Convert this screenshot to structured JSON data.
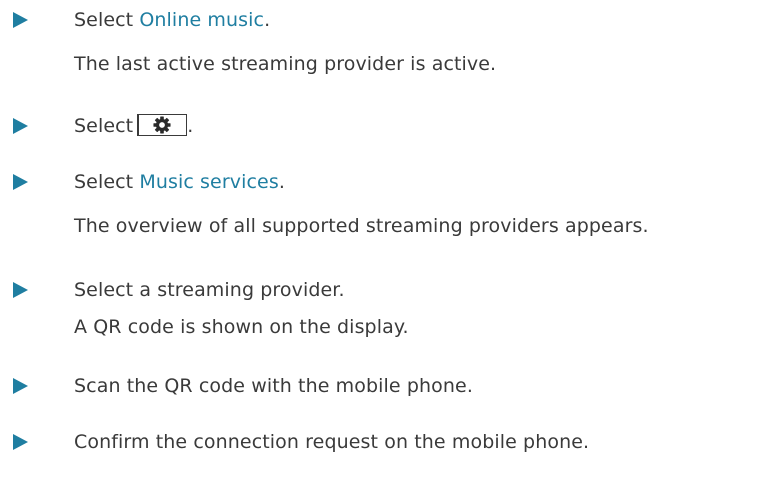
{
  "steps": [
    {
      "prefix": "Select ",
      "link": "Online music",
      "suffix": ".",
      "result": "The last active streaming provider is active."
    },
    {
      "prefix": "Select",
      "icon": "gear-icon",
      "suffix": "."
    },
    {
      "prefix": "Select ",
      "link": "Music services",
      "suffix": ".",
      "result": "The overview of all supported streaming providers appears."
    },
    {
      "text": "Select a streaming provider.",
      "result": "A QR code is shown on the display."
    },
    {
      "text": "Scan the QR code with the mobile phone."
    },
    {
      "text": "Confirm the connection request on the mobile phone."
    }
  ],
  "colors": {
    "accent": "#1f7ea1",
    "text": "#3a3a3a"
  }
}
